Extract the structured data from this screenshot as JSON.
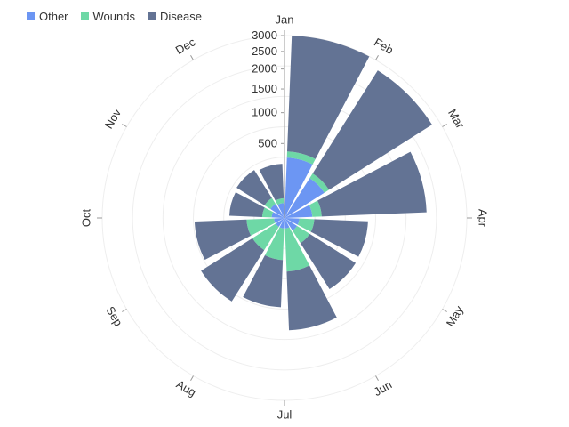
{
  "chart_data": {
    "type": "bar",
    "polar": true,
    "stacked": true,
    "radial_scale": "sqrt",
    "categories": [
      "Jan",
      "Feb",
      "Mar",
      "Apr",
      "May",
      "Jun",
      "Jul",
      "Aug",
      "Sep",
      "Oct",
      "Nov",
      "Dec"
    ],
    "series": [
      {
        "name": "Other",
        "color": "#6c96f3",
        "values": [
          330,
          200,
          70,
          20,
          20,
          10,
          10,
          10,
          10,
          15,
          25,
          20
        ]
      },
      {
        "name": "Wounds",
        "color": "#6ed8a6",
        "values": [
          70,
          50,
          55,
          60,
          60,
          250,
          150,
          120,
          120,
          30,
          25,
          15
        ]
      },
      {
        "name": "Disease",
        "color": "#637394",
        "values": [
          2600,
          2500,
          1700,
          550,
          560,
          880,
          560,
          750,
          600,
          230,
          240,
          230
        ]
      }
    ],
    "radial_ticks": [
      "500",
      "1000",
      "1500",
      "2000",
      "2500",
      "3000"
    ],
    "radial_tick_values": [
      500,
      1000,
      1500,
      2000,
      2500,
      3000
    ],
    "rmax": 3000,
    "legend_position": "top-left",
    "grid": true
  }
}
